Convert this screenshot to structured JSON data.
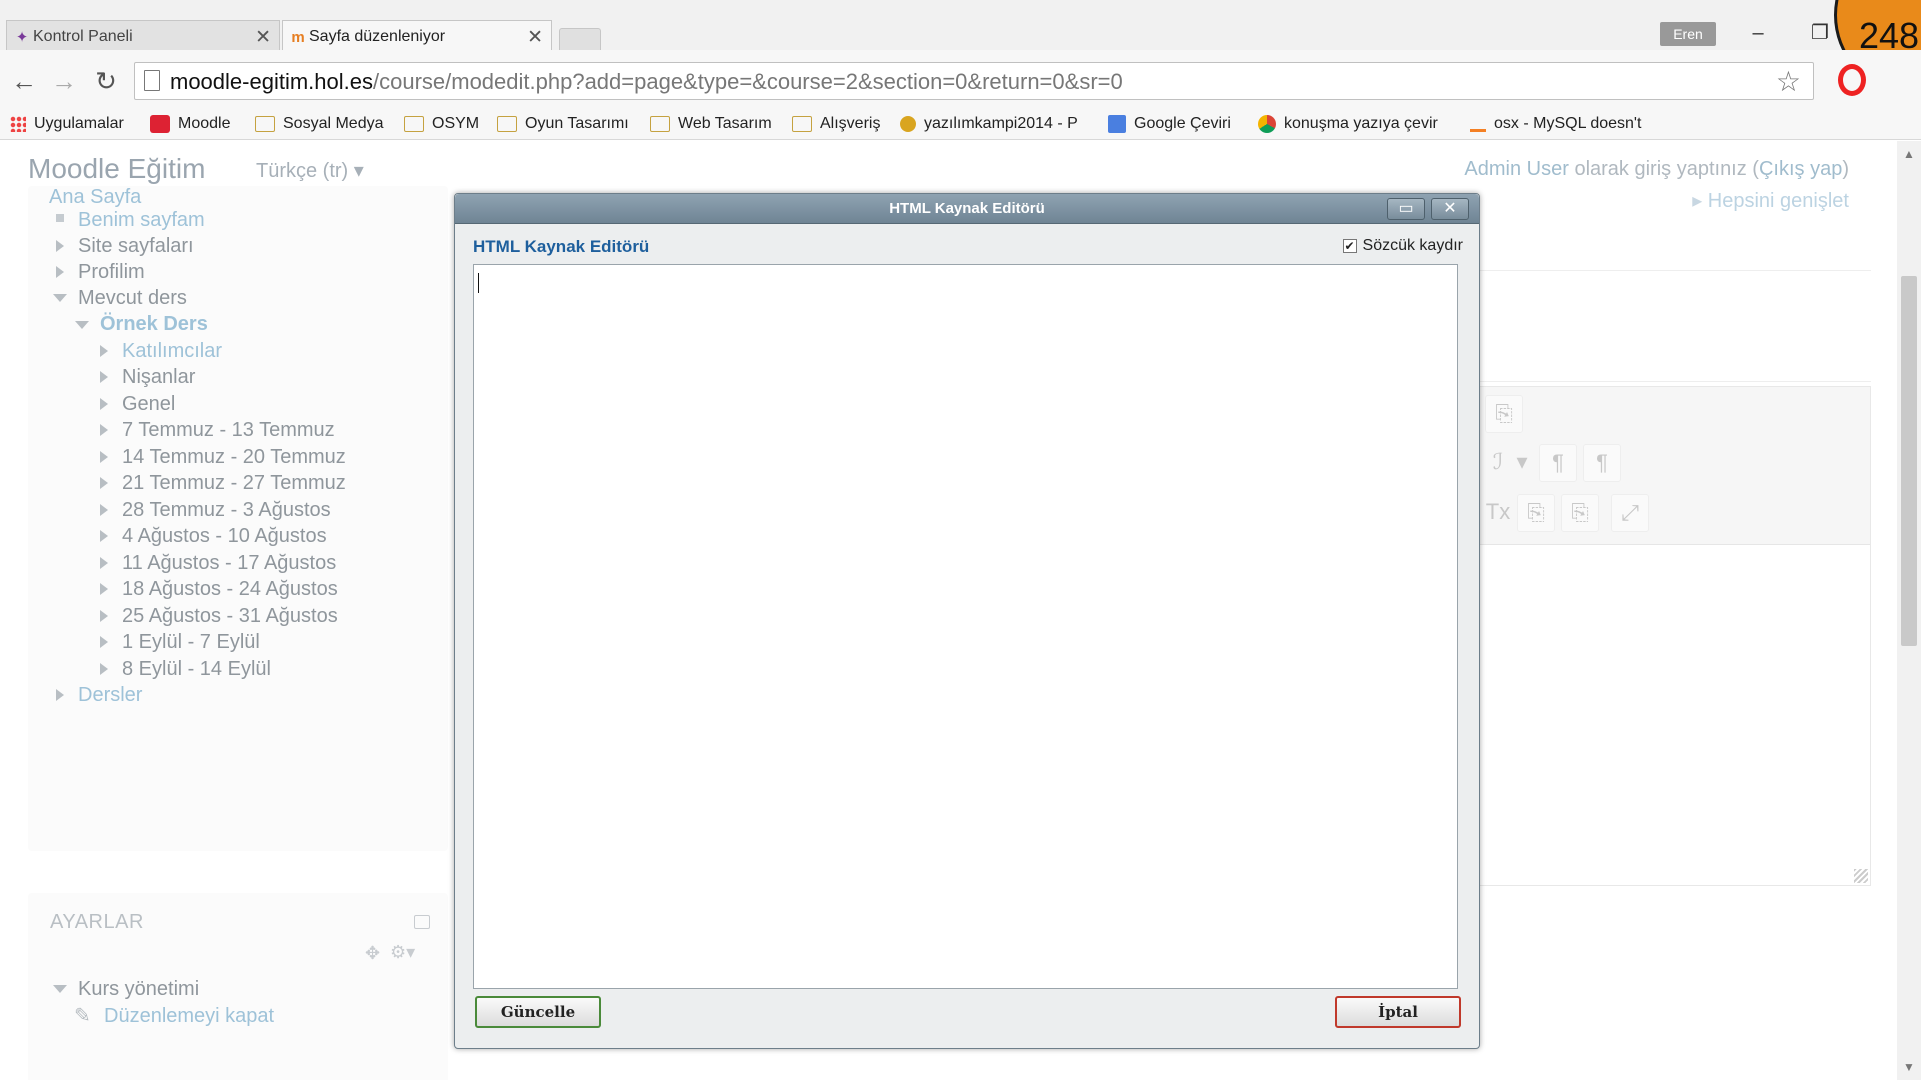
{
  "browser": {
    "tabs": [
      {
        "title": "Kontrol Paneli",
        "favicon": "puzzle-icon"
      },
      {
        "title": "Sayfa düzenleniyor",
        "favicon": "moodle-icon"
      }
    ],
    "profile_name": "Eren",
    "url_host": "moodle-egitim.hol.es",
    "url_path": "/course/modedit.php?add=page&type=&course=2&section=0&return=0&sr=0",
    "badge_count": "248",
    "bookmarks": [
      {
        "label": "Uygulamalar",
        "icon": "apps-grid-icon"
      },
      {
        "label": "Moodle",
        "icon": "moodle-icon"
      },
      {
        "label": "Sosyal Medya",
        "icon": "folder-icon"
      },
      {
        "label": "OSYM",
        "icon": "folder-icon"
      },
      {
        "label": "Oyun Tasarımı",
        "icon": "folder-icon"
      },
      {
        "label": "Web Tasarım",
        "icon": "folder-icon"
      },
      {
        "label": "Alışveriş",
        "icon": "folder-icon"
      },
      {
        "label": "yazılımkampi2014 - P",
        "icon": "site-icon"
      },
      {
        "label": "Google Çeviri",
        "icon": "translate-icon"
      },
      {
        "label": "konuşma yazıya çevir",
        "icon": "chrome-icon"
      },
      {
        "label": "osx - MySQL doesn't",
        "icon": "stack-icon"
      }
    ]
  },
  "header": {
    "site_name": "Moodle Eğitim",
    "language": "Türkçe (tr) ▾",
    "login_user": "Admin User",
    "login_text": " olarak giriş yaptınız (",
    "logout": "Çıkış yap",
    "login_close": ")"
  },
  "navigation": {
    "home": "Ana Sayfa",
    "items": [
      "Benim sayfam",
      "Site sayfaları",
      "Profilim",
      "Mevcut ders",
      "Örnek Ders",
      "Katılımcılar",
      "Nişanlar",
      "Genel",
      "7 Temmuz - 13 Temmuz",
      "14 Temmuz - 20 Temmuz",
      "21 Temmuz - 27 Temmuz",
      "28 Temmuz - 3 Ağustos",
      "4 Ağustos - 10 Ağustos",
      "11 Ağustos - 17 Ağustos",
      "18 Ağustos - 24 Ağustos",
      "25 Ağustos - 31 Ağustos",
      "1 Eylül - 7 Eylül",
      "8 Eylül - 14 Eylül",
      "Dersler"
    ]
  },
  "settings": {
    "title": "AYARLAR",
    "course_admin": "Kurs yönetimi",
    "edit_off": "Düzenlemeyi kapat"
  },
  "main": {
    "expand_all": "Hepsini genişlet"
  },
  "dialog": {
    "window_title": "HTML Kaynak Editörü",
    "heading": "HTML Kaynak Editörü",
    "word_wrap": "Sözcük kaydır",
    "word_wrap_checked": true,
    "content": "",
    "update_button": "Güncelle",
    "cancel_button": "İptal"
  }
}
